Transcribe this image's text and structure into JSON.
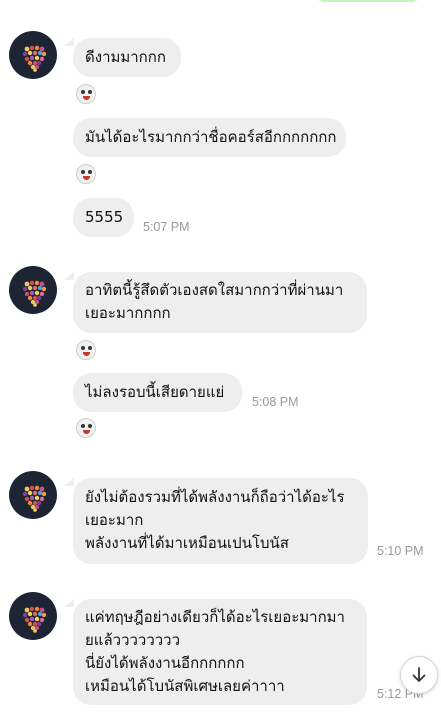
{
  "messages": [
    {
      "lines": [
        "ดีงามมากกก"
      ]
    },
    {
      "lines": [
        "มันได้อะไรมากกว่าชื่อคอร์สอีกกกกกกก"
      ]
    },
    {
      "lines": [
        "5555"
      ],
      "time": "5:07 PM"
    },
    {
      "lines": [
        "อาทิตนี้รู้สึดตัวเองสดใสมากกว่าที่ผ่านมา",
        "เยอะมากกกก"
      ]
    },
    {
      "lines": [
        "ไม่ลงรอบนี้เสียดายแย่"
      ],
      "time": "5:08 PM"
    },
    {
      "lines": [
        "ยังไม่ต้องรวมที่ได้พลังงานก็ถือว่าได้อะไร",
        "เยอะมาก",
        "พลังงานที่ได้มาเหมือนเปนโบนัส"
      ],
      "time": "5:10 PM"
    },
    {
      "lines": [
        "แค่ทฤษฎีอย่างเดียวก็ได้อะไรเยอะมากมา",
        "ยแล้วววววววว",
        "นี่ยังได้พลังงานอีกกกกกก",
        "เหมือนได้โบนัสพิเศษเลยค่าาาา"
      ],
      "time": "5:12 PM"
    }
  ],
  "stickers": [
    "smiling-sticker",
    "laughing-sticker",
    "grinning-sticker",
    "surprised-sticker"
  ],
  "colors": {
    "bubble": "#eeeeee",
    "avatar_bg": "#1d2433",
    "timestamp": "#9a9a9a",
    "sent_bubble": "#c9f3bd"
  }
}
